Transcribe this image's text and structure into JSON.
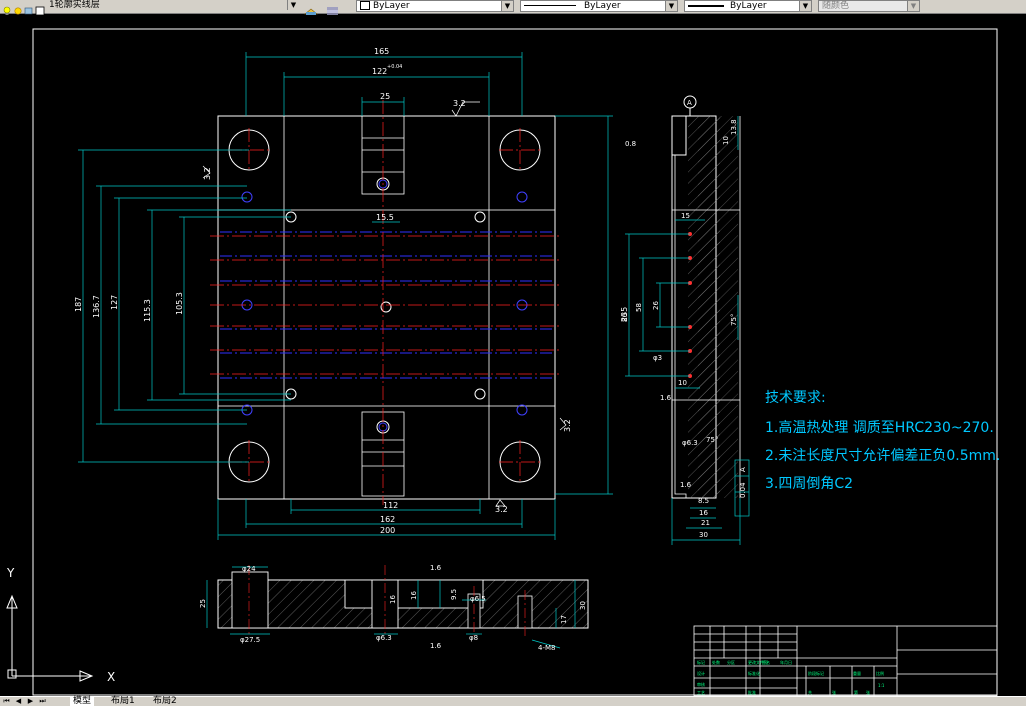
{
  "toolbar": {
    "layer_name": "1轮廓实线层",
    "color": "ByLayer",
    "linetype": "ByLayer",
    "lineweight": "ByLayer",
    "plot_style": "随颜色"
  },
  "tabs": [
    {
      "label": "模型"
    },
    {
      "label": "布局1"
    },
    {
      "label": "布局2"
    }
  ],
  "ucs": {
    "x_label": "X",
    "y_label": "Y"
  },
  "drawing": {
    "top_view_dims": [
      "165",
      "122",
      "25",
      "15.5",
      "187",
      "136.7",
      "127",
      "115.3",
      "105.3",
      "235",
      "112",
      "162",
      "200"
    ],
    "tolerance_upper": "+0.04",
    "tolerance_lower": "-0.02",
    "roughness": [
      "3.2",
      "3.2",
      "3.2",
      "3.2",
      "0.8",
      "1.6",
      "1.6",
      "1.6",
      "1.6"
    ],
    "side_view_dims": [
      "13.8",
      "10",
      "15",
      "86",
      "58",
      "26",
      "10",
      "φ3",
      "φ6.3",
      "75°",
      "8.5",
      "16",
      "21",
      "30",
      "0.04",
      "A"
    ],
    "section_dims": [
      "φ24",
      "25",
      "φ27.5",
      "16",
      "16",
      "9.5",
      "φ6.5",
      "φ6.3",
      "φ8",
      "17",
      "30",
      "4-M8"
    ],
    "datum_label": "A",
    "notes_title": "技术要求:",
    "notes": [
      "1.高温热处理 调质至HRC230~270.",
      "2.未注长度尺寸允许偏差正负0.5mm.",
      "3.四周倒角C2"
    ],
    "title_block": {
      "cells": [
        "标记",
        "处数",
        "分区",
        "更改文件号",
        "签名",
        "年月日",
        "设计",
        "标准化",
        "阶段标记",
        "重量",
        "比例",
        "审核",
        "工艺",
        "批准",
        "共",
        "张",
        "第",
        "张",
        "1:1"
      ]
    }
  }
}
